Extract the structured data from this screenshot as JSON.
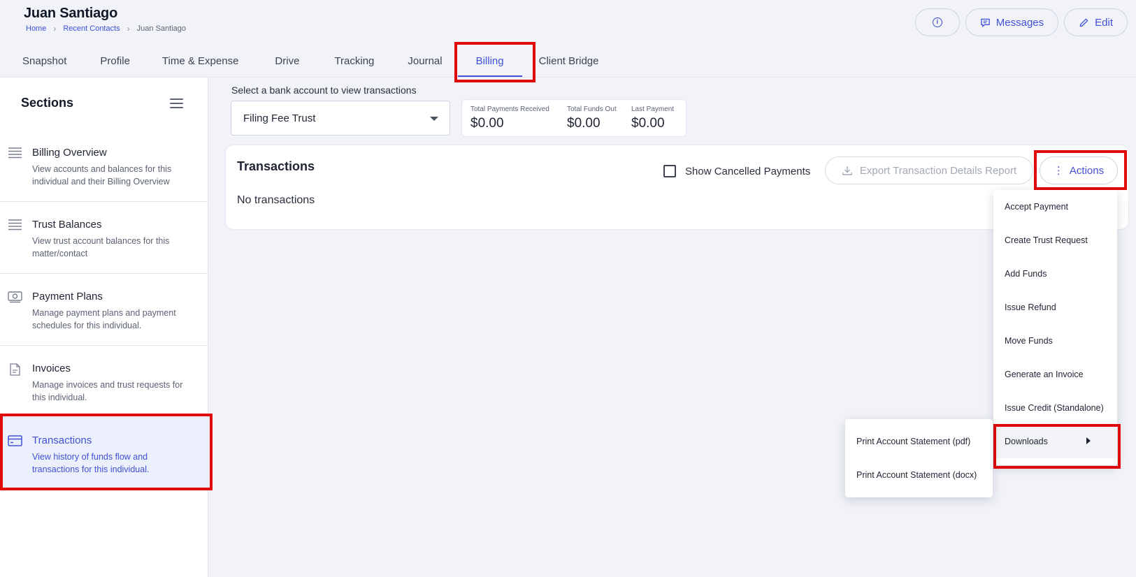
{
  "header": {
    "contact_name": "Juan Santiago",
    "breadcrumb": [
      "Home",
      "Recent Contacts",
      "Juan Santiago"
    ],
    "messages_label": "Messages",
    "edit_label": "Edit",
    "info_icon": "i"
  },
  "tabs": [
    {
      "label": "Snapshot"
    },
    {
      "label": "Profile"
    },
    {
      "label": "Time & Expense"
    },
    {
      "label": "Drive"
    },
    {
      "label": "Tracking"
    },
    {
      "label": "Journal"
    },
    {
      "label": "Billing",
      "active": true
    },
    {
      "label": "Client Bridge"
    }
  ],
  "sidebar": {
    "title": "Sections",
    "items": [
      {
        "name": "Billing Overview",
        "desc": "View accounts and balances for this individual and their Billing Overview",
        "icon": "list-icon"
      },
      {
        "name": "Trust Balances",
        "desc": "View trust account balances for this matter/contact",
        "icon": "list-icon"
      },
      {
        "name": "Payment Plans",
        "desc": "Manage payment plans and payment schedules for this individual.",
        "icon": "cash-icon"
      },
      {
        "name": "Invoices",
        "desc": "Manage invoices and trust requests for this individual.",
        "icon": "document-icon"
      },
      {
        "name": "Transactions",
        "desc": "View history of funds flow and transactions for this individual.",
        "icon": "credit-card-icon",
        "active": true
      }
    ]
  },
  "bank": {
    "label": "Select a bank account to view transactions",
    "selected": "Filing Fee Trust"
  },
  "stats": [
    {
      "label": "Total Payments Received",
      "value": "$0.00"
    },
    {
      "label": "Total Funds Out",
      "value": "$0.00"
    },
    {
      "label": "Last Payment",
      "value": "$0.00"
    }
  ],
  "transactions": {
    "title": "Transactions",
    "empty": "No transactions",
    "show_cancelled_label": "Show Cancelled Payments",
    "show_cancelled_checked": false,
    "export_label": "Export Transaction Details Report",
    "actions_label": "Actions",
    "actions_glyph": "⋮"
  },
  "actions_menu": [
    "Accept Payment",
    "Create Trust Request",
    "Add Funds",
    "Issue Refund",
    "Move Funds",
    "Generate an Invoice",
    "Issue Credit (Standalone)",
    "Downloads"
  ],
  "downloads_submenu": [
    "Print Account Statement (pdf)",
    "Print Account Statement (docx)"
  ],
  "colors": {
    "accent": "#4150d6",
    "highlight": "#e00a0a",
    "background": "#f1f3f8"
  }
}
